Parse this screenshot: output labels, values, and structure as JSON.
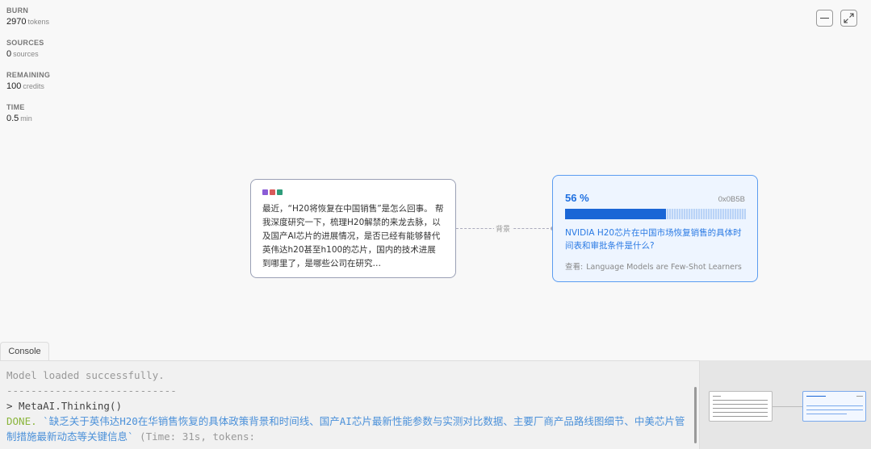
{
  "stats": [
    {
      "label": "BURN",
      "value": "2970",
      "unit": "tokens"
    },
    {
      "label": "SOURCES",
      "value": "0",
      "unit": "sources"
    },
    {
      "label": "REMAINING",
      "value": "100",
      "unit": "credits"
    },
    {
      "label": "TIME",
      "value": "0.5",
      "unit": "min"
    }
  ],
  "query_node": {
    "colors": [
      "#8a5cd6",
      "#d85a5a",
      "#2e9c7a"
    ],
    "text": "最近，“H20将恢复在中国销售”是怎么回事。 帮我深度研究一下，梳理H20解禁的来龙去脉，以及国产AI芯片的进展情况，是否已经有能够替代英伟达h20甚至h100的芯片，国内的技术进展到哪里了，是哪些公司在研究…"
  },
  "connector": {
    "label": "背景"
  },
  "task_node": {
    "percent_label": "56 %",
    "progress": 0.56,
    "code": "0x0B5B",
    "title": "NVIDIA H20芯片在中国市场恢复销售的具体时间表和审批条件是什么?",
    "ref_label": "查看:",
    "ref_value": "Language Models are Few-Shot Learners"
  },
  "console": {
    "tab_label": "Console",
    "line1": "Model loaded successfully.",
    "line2": "----------------------------",
    "line3": "> MetaAI.Thinking()",
    "done_label": "DONE.",
    "done_message": "`缺乏关于英伟达H20在华销售恢复的具体政策背景和时间线、国产AI芯片最新性能参数与实测对比数据、主要厂商产品路线图细节、中美芯片管制措施最新动态等关键信息`",
    "time_text": " (Time: 31s, tokens:"
  },
  "window_buttons": {
    "minimize_icon": "minimize-icon",
    "expand_icon": "expand-icon"
  }
}
